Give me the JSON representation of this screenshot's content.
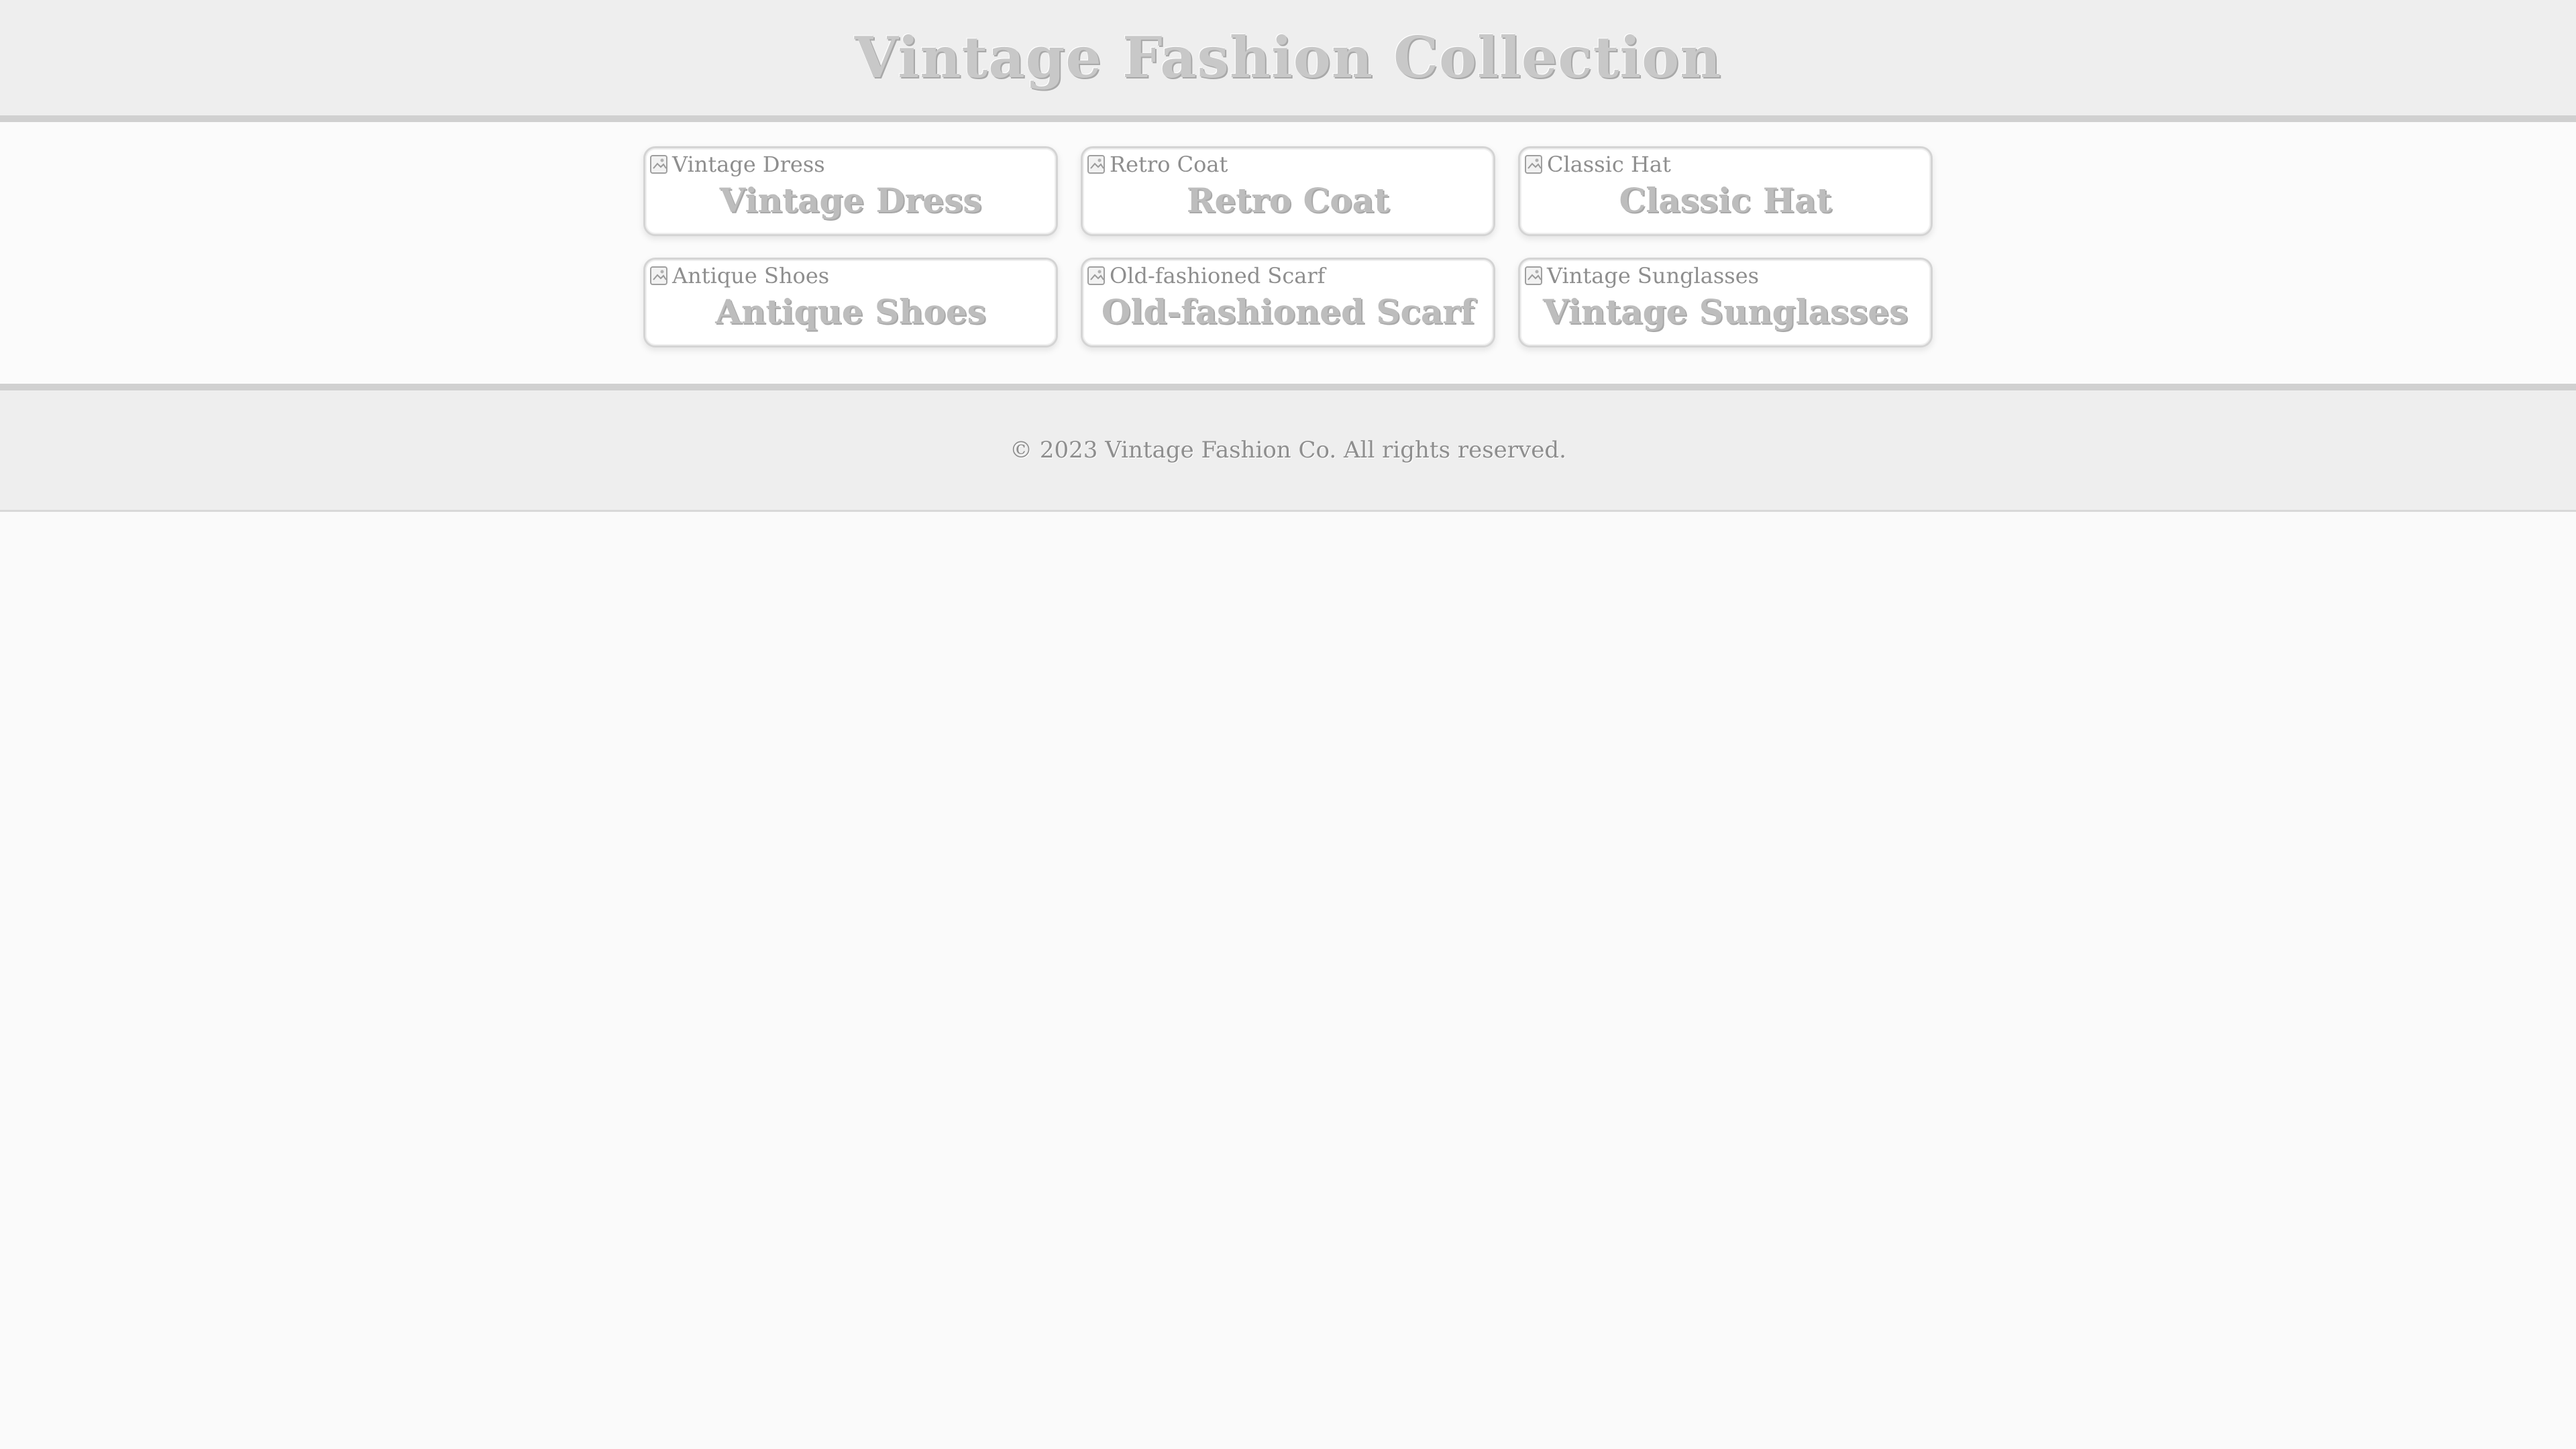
{
  "header": {
    "title": "Vintage Fashion Collection"
  },
  "products": [
    {
      "alt": "Vintage Dress",
      "name": "Vintage Dress"
    },
    {
      "alt": "Retro Coat",
      "name": "Retro Coat"
    },
    {
      "alt": "Classic Hat",
      "name": "Classic Hat"
    },
    {
      "alt": "Antique Shoes",
      "name": "Antique Shoes"
    },
    {
      "alt": "Old-fashioned Scarf",
      "name": "Old-fashioned Scarf"
    },
    {
      "alt": "Vintage Sunglasses",
      "name": "Vintage Sunglasses"
    }
  ],
  "footer": {
    "copyright": "© 2023 Vintage Fashion Co. All rights reserved."
  },
  "icons": {
    "image_placeholder": "broken-image-icon"
  },
  "colors": {
    "header_bg": "#eeeeee",
    "title_text": "#c8c8c8",
    "card_border": "#d4d4d4",
    "footer_text": "#8e8e8e"
  }
}
